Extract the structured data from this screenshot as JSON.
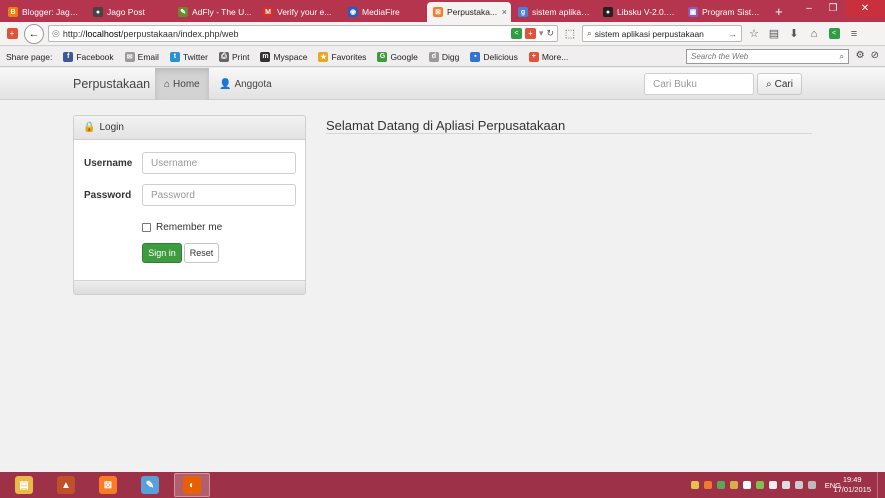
{
  "browser": {
    "tabs": [
      {
        "title": "Blogger: Jago ...",
        "icon": "blogger-icon",
        "color": "#f57d00",
        "glyph": "B"
      },
      {
        "title": "Jago Post",
        "icon": "jagopost-icon",
        "color": "#444444",
        "glyph": "●"
      },
      {
        "title": "AdFly - The U...",
        "icon": "adfly-icon",
        "color": "#6a8a2a",
        "glyph": "✎"
      },
      {
        "title": "Verify your e...",
        "icon": "gmail-icon",
        "color": "#d93025",
        "glyph": "M"
      },
      {
        "title": "MediaFire",
        "icon": "mediafire-icon",
        "color": "#1f5fbf",
        "glyph": "◉"
      },
      {
        "title": "Perpustaka...",
        "icon": "xampp-icon",
        "color": "#fb7a24",
        "glyph": "⊠",
        "active": true
      },
      {
        "title": "sistem aplikasi...",
        "icon": "google-icon",
        "color": "#4a7fe0",
        "glyph": "g"
      },
      {
        "title": "Libsku V-2.0.1...",
        "icon": "github-icon",
        "color": "#222222",
        "glyph": "●"
      },
      {
        "title": "Program Siste...",
        "icon": "blog-icon",
        "color": "#8a5bb5",
        "glyph": "▣"
      }
    ],
    "tab_close": "×",
    "new_tab": "+",
    "window_controls": {
      "minimize": "–",
      "maximize": "❐",
      "close": "✕"
    },
    "url_prefix": "http://",
    "url_host": "localhost",
    "url_path": "/perpustakaan/index.php/web",
    "search_query": "sistem aplikasi perpustakaan",
    "share_label": "Share page:",
    "share_items": [
      {
        "label": "Facebook",
        "icon": "facebook-icon",
        "color": "#3b5998",
        "glyph": "f"
      },
      {
        "label": "Email",
        "icon": "email-icon",
        "color": "#9a9a9a",
        "glyph": "✉"
      },
      {
        "label": "Twitter",
        "icon": "twitter-icon",
        "color": "#2a90d0",
        "glyph": "t"
      },
      {
        "label": "Print",
        "icon": "print-icon",
        "color": "#666666",
        "glyph": "⎙"
      },
      {
        "label": "Myspace",
        "icon": "myspace-icon",
        "color": "#333333",
        "glyph": "m"
      },
      {
        "label": "Favorites",
        "icon": "favorites-icon",
        "color": "#e8a526",
        "glyph": "★"
      },
      {
        "label": "Google",
        "icon": "google-bookmark-icon",
        "color": "#3c9b3c",
        "glyph": "G"
      },
      {
        "label": "Digg",
        "icon": "digg-icon",
        "color": "#9a9a9a",
        "glyph": "d"
      },
      {
        "label": "Delicious",
        "icon": "delicious-icon",
        "color": "#3274d0",
        "glyph": "▪"
      },
      {
        "label": "More...",
        "icon": "more-icon",
        "color": "#e0523a",
        "glyph": "+"
      }
    ],
    "web_search_placeholder": "Search the Web"
  },
  "app": {
    "brand": "Perpustakaan",
    "nav": [
      {
        "label": "Home",
        "icon": "home-icon",
        "active": true
      },
      {
        "label": "Anggota",
        "icon": "user-icon",
        "active": false
      }
    ],
    "search_placeholder": "Cari Buku",
    "search_button": "Cari",
    "login": {
      "title": "Login",
      "username_label": "Username",
      "username_placeholder": "Username",
      "password_label": "Password",
      "password_placeholder": "Password",
      "remember_label": "Remember me",
      "signin_label": "Sign in",
      "reset_label": "Reset"
    },
    "welcome": "Selamat Datang di Apliasi Perpusatakaan"
  },
  "taskbar": {
    "apps": [
      {
        "icon": "file-explorer-icon",
        "color": "#e9b94a",
        "glyph": "▤"
      },
      {
        "icon": "matlab-icon",
        "color": "#c0502a",
        "glyph": "▲"
      },
      {
        "icon": "xampp-taskbar-icon",
        "color": "#fb7a24",
        "glyph": "⊠"
      },
      {
        "icon": "paint-icon",
        "color": "#5aa0d8",
        "glyph": "✎"
      },
      {
        "icon": "firefox-icon",
        "color": "#e66000",
        "glyph": "◐",
        "active": true
      }
    ],
    "language": "ENG",
    "time": "19:49",
    "date": "17/01/2015"
  }
}
